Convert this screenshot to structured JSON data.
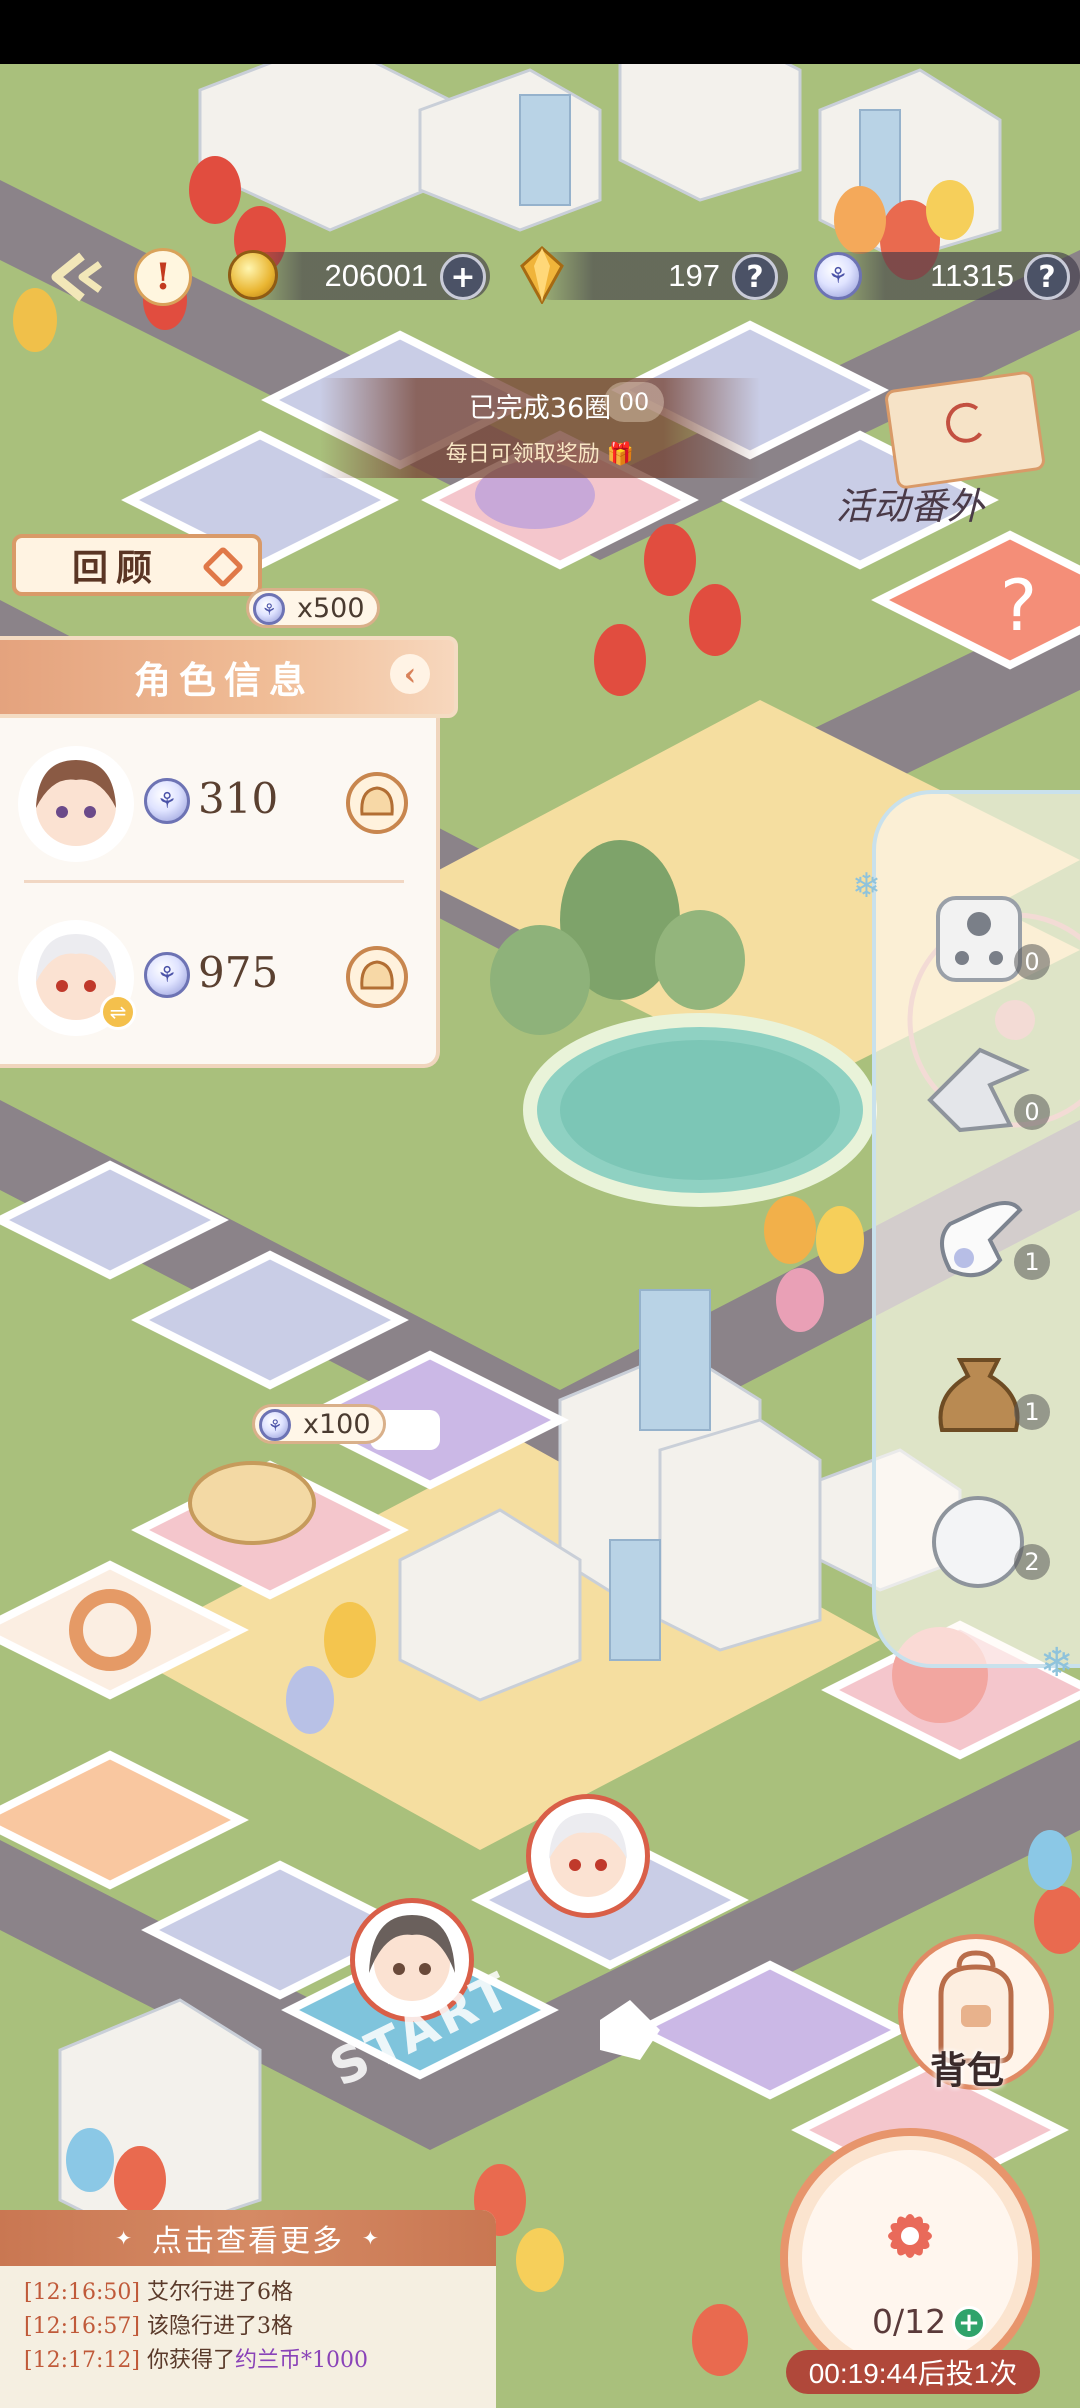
{
  "resources": {
    "gold": "206001",
    "crystal": "197",
    "token": "11315"
  },
  "round": {
    "text": "已完成36圈",
    "sub": "每日可领取奖励",
    "tile_value": "00"
  },
  "review_label": "回顾",
  "tag_500": "x500",
  "tag_100": "x100",
  "role_panel": {
    "title": "角色信息",
    "rows": [
      {
        "value": "310"
      },
      {
        "value": "975"
      }
    ]
  },
  "event_banner": "活动番外",
  "items": [
    {
      "name": "dice",
      "count": "0"
    },
    {
      "name": "boomerang",
      "count": "0"
    },
    {
      "name": "glove",
      "count": "1"
    },
    {
      "name": "sack",
      "count": "1"
    },
    {
      "name": "snowball",
      "count": "2"
    }
  ],
  "bag_label": "背包",
  "dice_status": {
    "count": "0/12",
    "plus": "+",
    "timer": "00:19:44后投1次"
  },
  "log": {
    "header": "点击查看更多",
    "lines": [
      {
        "ts": "[12:16:50]",
        "text": "艾尔行进了6格",
        "hl": ""
      },
      {
        "ts": "[12:16:57]",
        "text": "该隐行进了3格",
        "hl": ""
      },
      {
        "ts": "[12:17:12]",
        "text": "你获得了",
        "hl": "约兰币*1000"
      }
    ]
  },
  "start_label": "START",
  "colors": {
    "grass": "#a9c07c",
    "road": "#8b8389",
    "sand": "#f5dea0",
    "tile_blue": "#c9cde6",
    "tile_pink": "#f4c6cc",
    "tile_purple": "#cbb8e6",
    "accent": "#d9825a"
  }
}
